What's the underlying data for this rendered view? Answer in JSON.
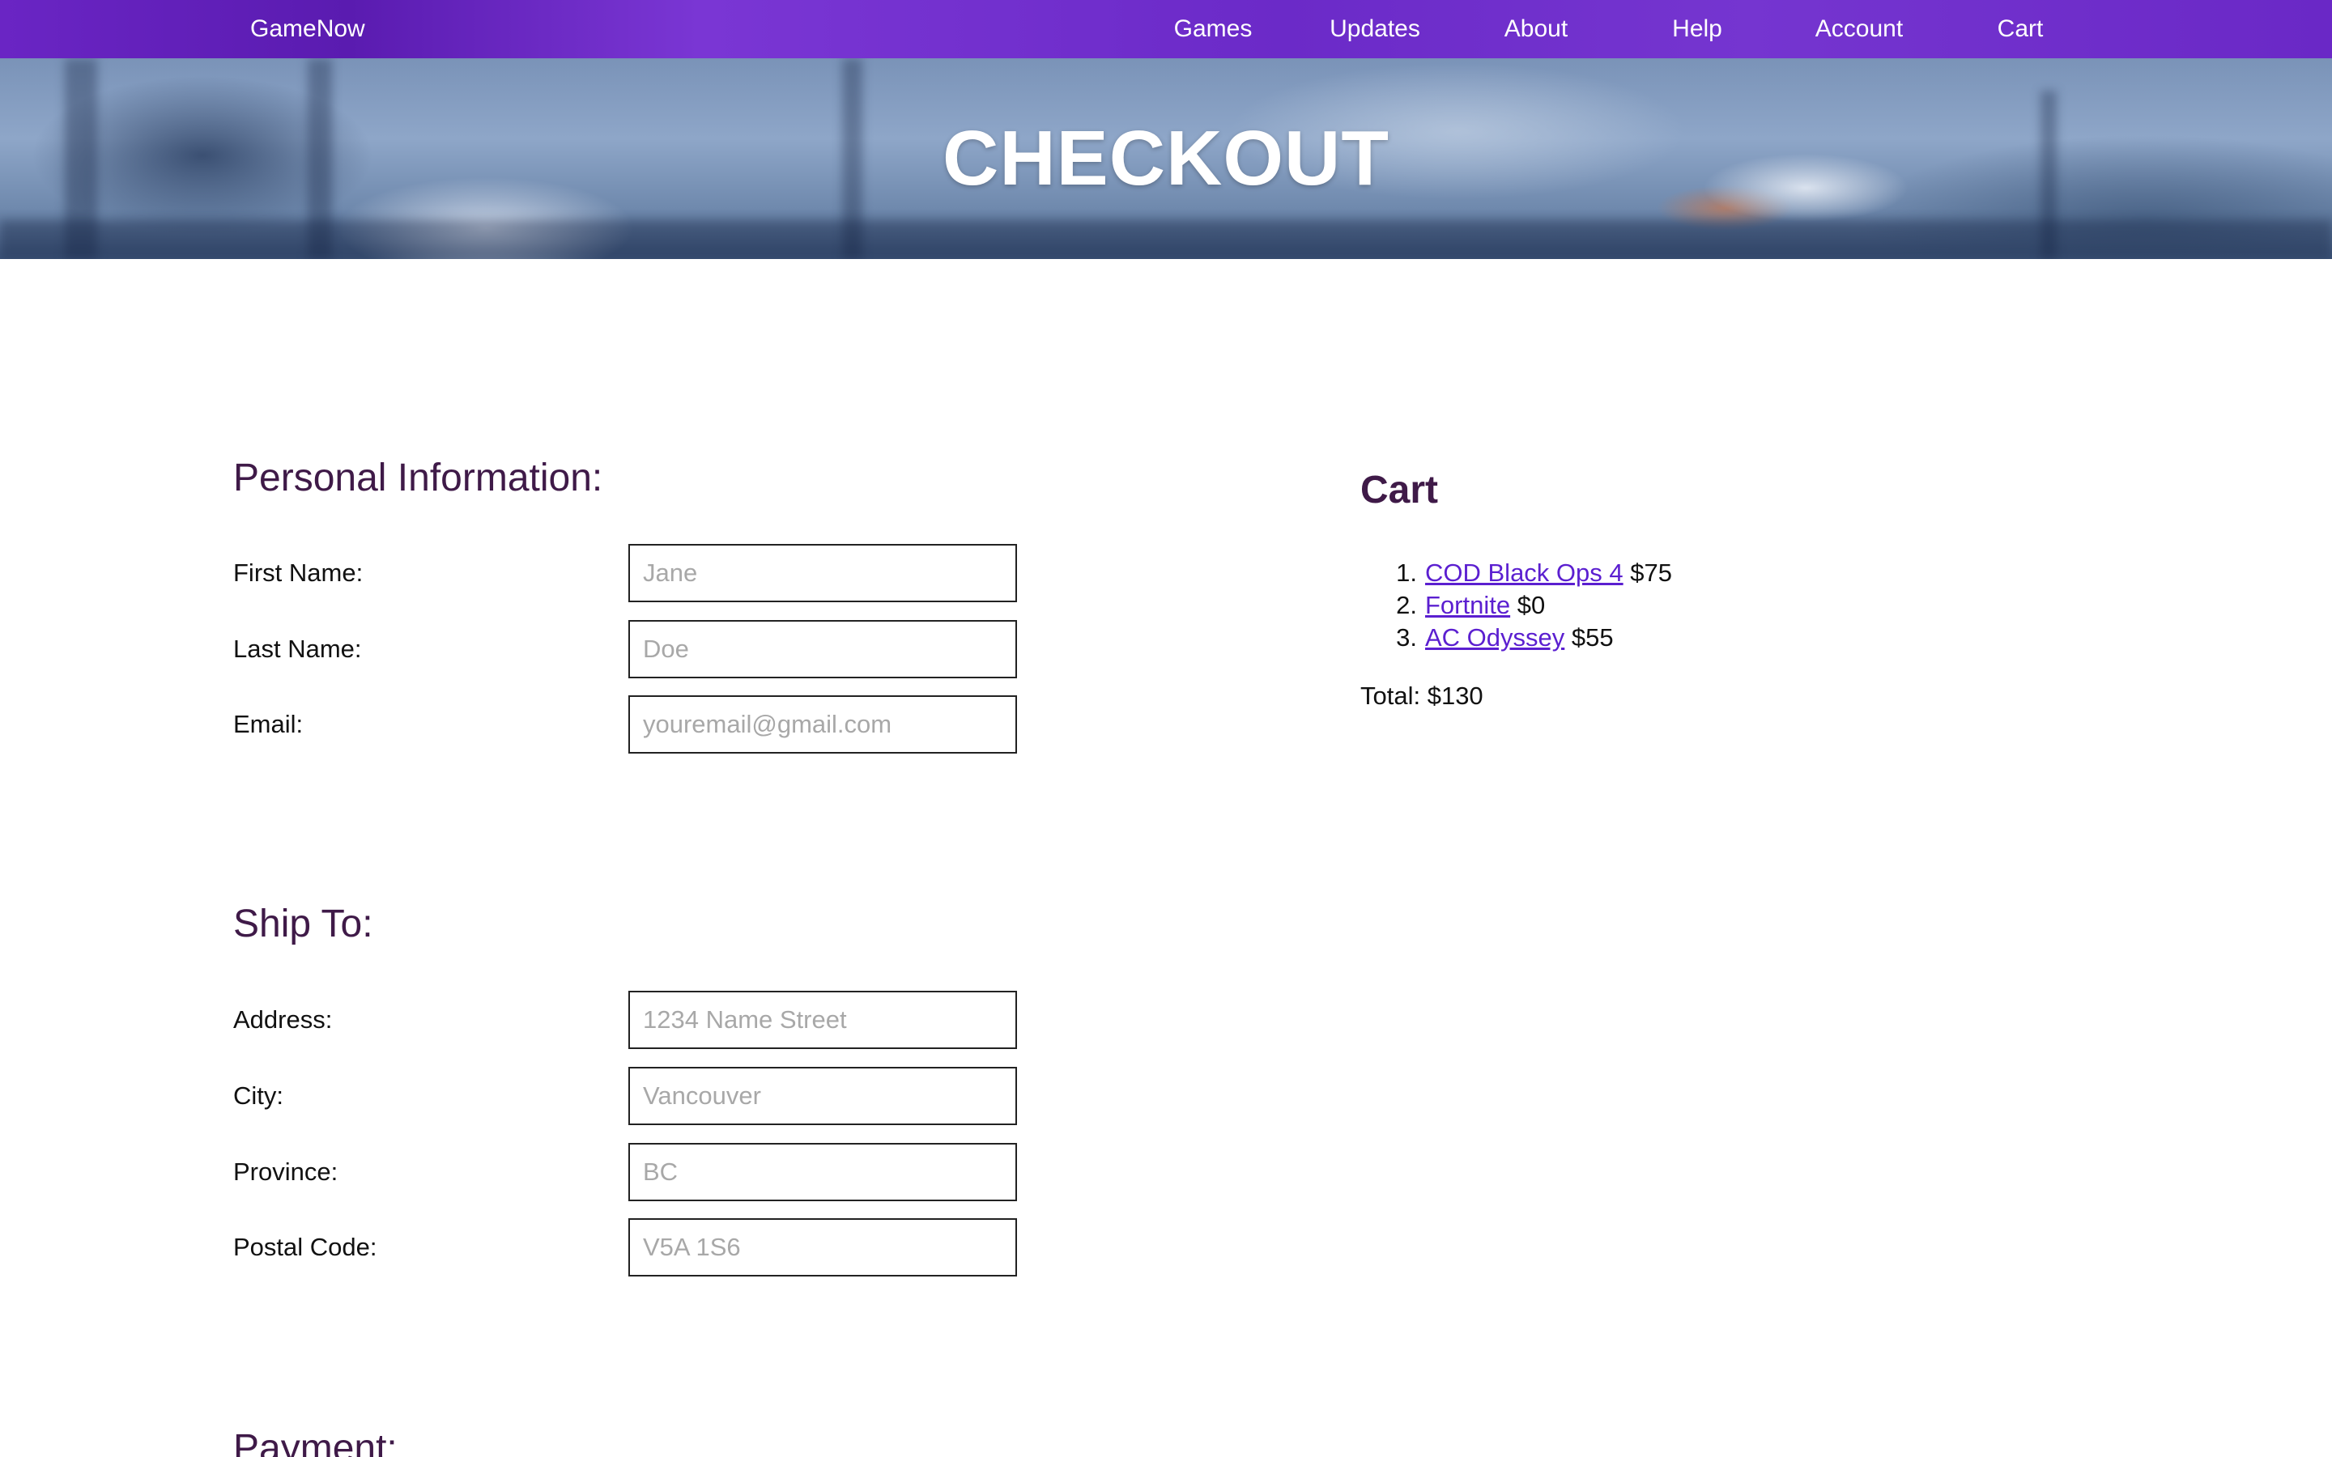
{
  "nav": {
    "brand": "GameNow",
    "links": [
      "Games",
      "Updates",
      "About",
      "Help",
      "Account",
      "Cart"
    ]
  },
  "hero": {
    "title": "CHECKOUT"
  },
  "personal": {
    "heading": "Personal Information:",
    "first_name_label": "First Name:",
    "first_name_placeholder": "Jane",
    "last_name_label": "Last Name:",
    "last_name_placeholder": "Doe",
    "email_label": "Email:",
    "email_placeholder": "youremail@gmail.com"
  },
  "ship": {
    "heading": "Ship To:",
    "address_label": "Address:",
    "address_placeholder": "1234 Name Street",
    "city_label": "City:",
    "city_placeholder": "Vancouver",
    "province_label": "Province:",
    "province_placeholder": "BC",
    "postal_label": "Postal Code:",
    "postal_placeholder": "V5A 1S6"
  },
  "payment": {
    "heading": "Payment:"
  },
  "cart": {
    "heading": "Cart",
    "items": [
      {
        "num": "1.",
        "name": "COD Black Ops 4",
        "price": "$75"
      },
      {
        "num": "2.",
        "name": "Fortnite",
        "price": "$0"
      },
      {
        "num": "3.",
        "name": "AC Odyssey",
        "price": "$55"
      }
    ],
    "total": "Total: $130"
  },
  "colors": {
    "nav_bg": "#6a28c6",
    "heading": "#3f1a48",
    "link": "#5b1fd0"
  }
}
